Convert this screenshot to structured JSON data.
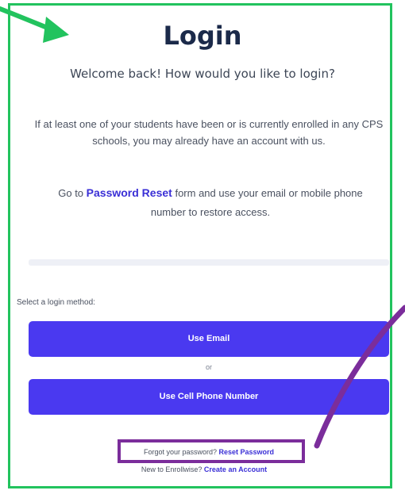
{
  "login": {
    "title": "Login",
    "welcome": "Welcome back! How would you like to login?",
    "info": "If at least one of your students have been or is currently enrolled in any CPS schools, you may already have an account with us.",
    "reset_prefix": "Go to",
    "reset_link": "Password Reset",
    "reset_suffix": "form and use your email or mobile phone number to restore access.",
    "method_label": "Select a login method:",
    "email_button": "Use Email",
    "or_text": "or",
    "phone_button": "Use Cell Phone Number",
    "forgot_text": "Forgot your password?",
    "forgot_link": "Reset Password",
    "new_text": "New to Enrollwise?",
    "create_link": "Create an Account"
  },
  "colors": {
    "frame": "#22c35e",
    "button": "#4a39f0",
    "link": "#3a2fd6",
    "highlight_box": "#7b2d9b",
    "arrow_green": "#22c35e",
    "arrow_purple": "#7b2d9b"
  },
  "annotations": {
    "green_arrow": "arrow-icon",
    "purple_arrow": "arrow-icon"
  }
}
